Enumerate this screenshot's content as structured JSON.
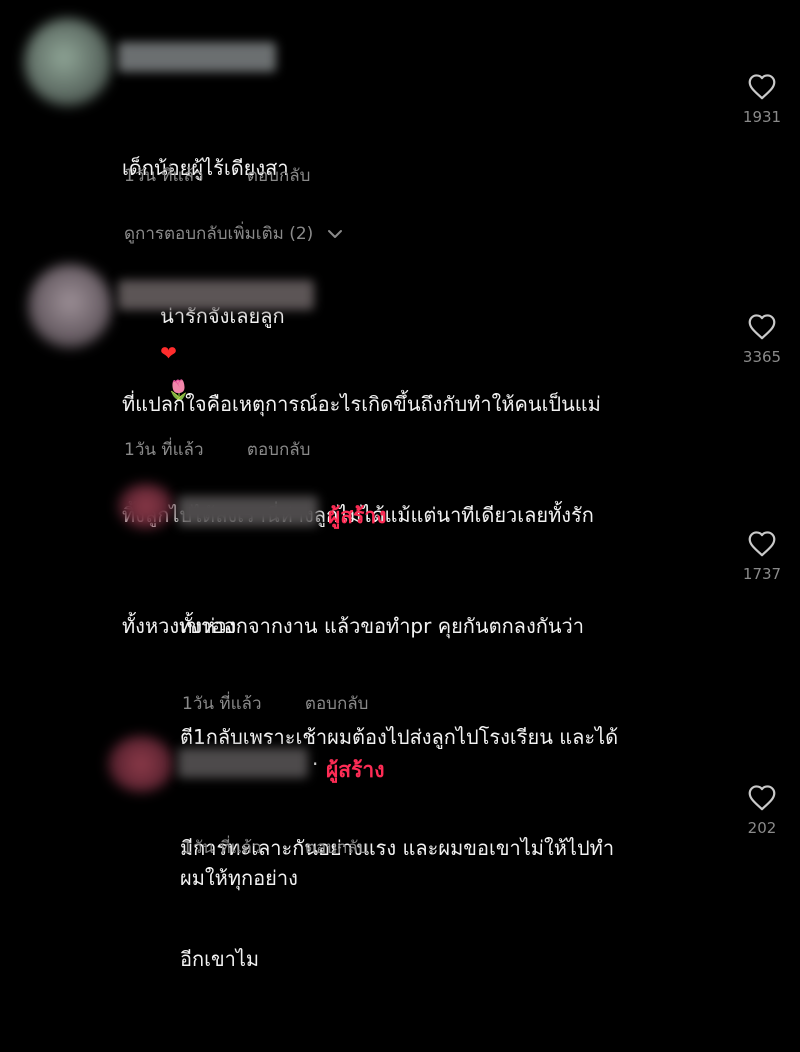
{
  "comments": [
    {
      "text_lines": [
        "เด็กน้อยผู้ไร้เดียงสา",
        "น่ารักจังเลยลูก"
      ],
      "emojis": [
        "❤",
        "🌷"
      ],
      "time": "1วัน ที่แล้ว",
      "reply": "ตอบกลับ",
      "likes": "1931"
    },
    {
      "text_lines": [
        "ที่แปลกใจคือเหตุการณ์อะไรเกิดขึ้นถึงกับทำให้คนเป็นแม่",
        "ทิ้งลูกไปได้ลงเรานี่ห่างลูกไม่ได้แม้แต่นาทีเดียวเลยทั้งรัก",
        "ทั้งหวงทั้งห่วง"
      ],
      "time": "1วัน ที่แล้ว",
      "reply": "ตอบกลับ",
      "likes": "3365"
    },
    {
      "creator": "ผู้สร้าง",
      "text_lines": [
        "เขาออกจากงาน แล้วขอทำpr คุยกันตกลงกันว่า",
        "ตี1กลับเพราะเช้าผมต้องไปส่งลูกไปโรงเรียน และได้",
        "มีการทะเลาะกันอย่างแรง และผมขอเขาไม่ให้ไปทำ",
        "อีกเขาไม"
      ],
      "time": "1วัน ที่แล้ว",
      "reply": "ตอบกลับ",
      "likes": "1737"
    },
    {
      "creator_dot": "·",
      "creator": "ผู้สร้าง",
      "text_lines": [
        "ผมให้ทุกอย่าง"
      ],
      "time": "1วัน ที่แล้ว",
      "reply": "ตอบกลับ",
      "likes": "202"
    }
  ],
  "view_more": "ดูการตอบกลับเพิ่มเติม (2)",
  "colors": {
    "background": "#000000",
    "text": "#f2f2f2",
    "muted": "#8a8a8a",
    "creator_badge": "#fe2c55"
  },
  "icons": {
    "like": "heart-outline-icon",
    "expand": "chevron-down-icon"
  }
}
